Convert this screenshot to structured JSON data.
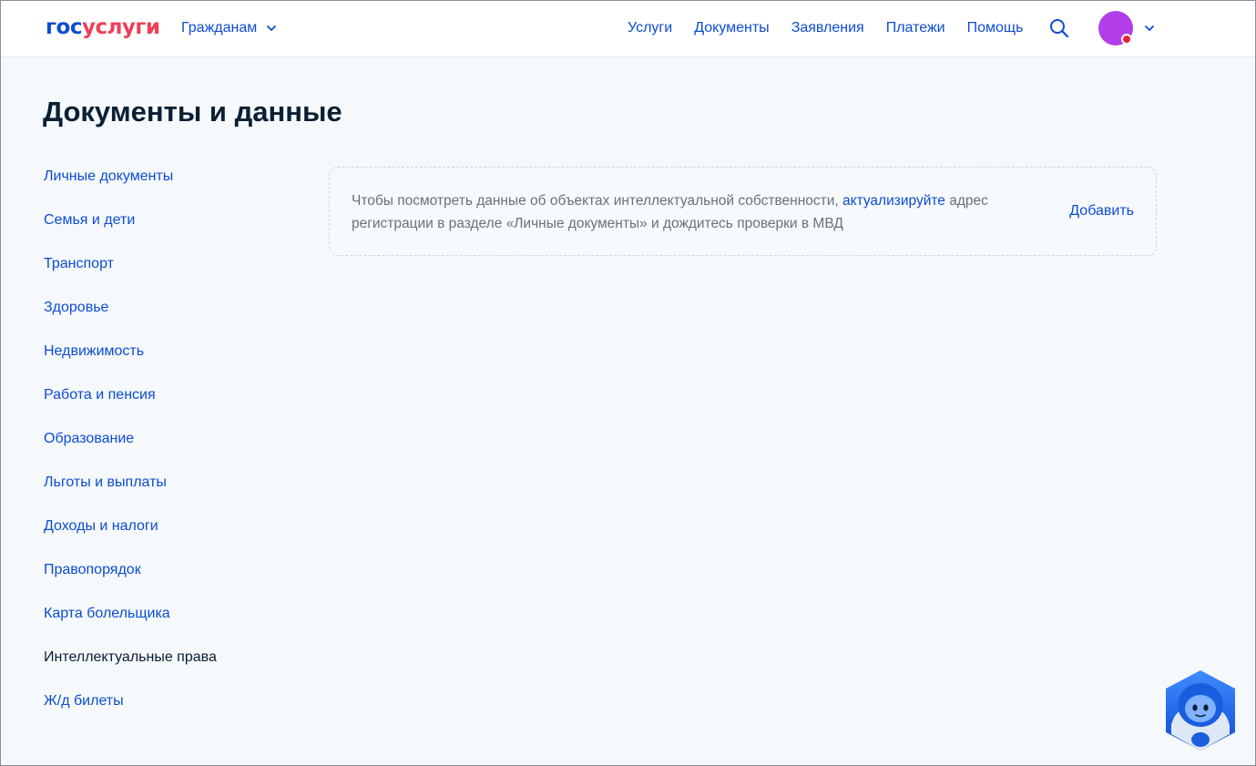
{
  "header": {
    "logo_part1": "гос",
    "logo_part2": "услуги",
    "audience_label": "Гражданам",
    "nav": [
      "Услуги",
      "Документы",
      "Заявления",
      "Платежи",
      "Помощь"
    ]
  },
  "page": {
    "title": "Документы и данные"
  },
  "sidebar": {
    "items": [
      {
        "label": "Личные документы"
      },
      {
        "label": "Семья и дети"
      },
      {
        "label": "Транспорт"
      },
      {
        "label": "Здоровье"
      },
      {
        "label": "Недвижимость"
      },
      {
        "label": "Работа и пенсия"
      },
      {
        "label": "Образование"
      },
      {
        "label": "Льготы и выплаты"
      },
      {
        "label": "Доходы и налоги"
      },
      {
        "label": "Правопорядок"
      },
      {
        "label": "Карта болельщика"
      },
      {
        "label": "Интеллектуальные права"
      },
      {
        "label": "Ж/д билеты"
      }
    ],
    "active_label": "Интеллектуальные права"
  },
  "notice": {
    "text_before": "Чтобы посмотреть данные об объектах интеллектуальной собственности, ",
    "link_text": "актуализируйте",
    "text_after": " адрес регистрации в разделе «Личные документы» и дождитесь проверки в МВД",
    "action_label": "Добавить"
  },
  "colors": {
    "brand_blue": "#0d4cd3",
    "brand_red": "#ee3f58",
    "avatar": "#b13ee8",
    "avatar_badge": "#ee1f3c",
    "background": "#f5f9fc"
  },
  "icons": {
    "search": "search-icon",
    "chevron": "chevron-down-icon",
    "assistant": "robot-assistant-icon"
  }
}
